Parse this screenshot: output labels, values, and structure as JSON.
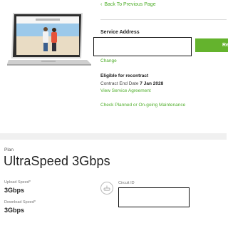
{
  "nav": {
    "back_label": "Back To Previous Page"
  },
  "service": {
    "address_label": "Service Address",
    "address_value": "",
    "button_label": "Re",
    "change_label": "Change"
  },
  "eligibility": {
    "title": "Eligible for recontract",
    "contract_prefix": "Contract End Date",
    "contract_date": "7 Jan 2028",
    "view_agreement": "View Service Agreement",
    "maintenance_link": "Check Planned or On-going Maintenance"
  },
  "plan": {
    "label": "Plan",
    "name": "UltraSpeed 3Gbps",
    "upload_label": "Upload Speed*",
    "upload_value": "3Gbps",
    "download_label": "Download Speed*",
    "download_value": "3Gbps",
    "circuit_label": "Circuit ID",
    "circuit_value": ""
  },
  "colors": {
    "accent": "#64b32d",
    "link": "#4fae2a"
  }
}
